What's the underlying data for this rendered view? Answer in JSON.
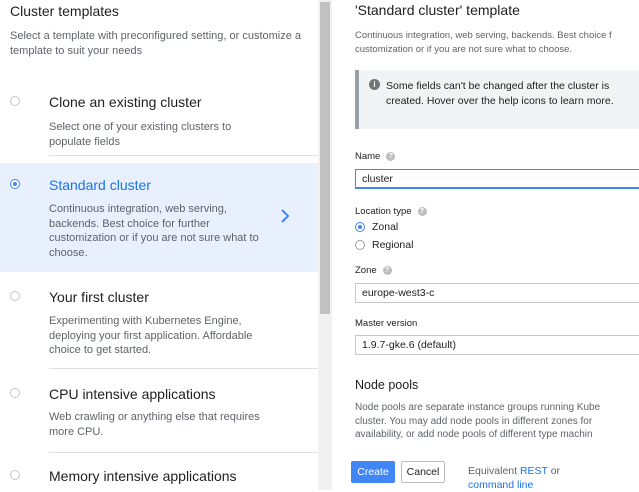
{
  "left": {
    "title": "Cluster templates",
    "subtitle": "Select a template with preconfigured setting, or customize a template to suit your needs",
    "templates": [
      {
        "title": "Clone an existing cluster",
        "description": "Select one of your existing clusters to populate fields"
      },
      {
        "title": "Standard cluster",
        "description": "Continuous integration, web serving, backends. Best choice for further customization or if you are not sure what to choose."
      },
      {
        "title": "Your first cluster",
        "description": "Experimenting with Kubernetes Engine, deploying your first application. Affordable choice to get started."
      },
      {
        "title": "CPU intensive applications",
        "description": "Web crawling or anything else that requires more CPU."
      },
      {
        "title": "Memory intensive applications",
        "description": ""
      }
    ],
    "selected_index": 1
  },
  "right": {
    "title": "'Standard cluster' template",
    "subtitle_line1": "Continuous integration, web serving, backends. Best choice f",
    "subtitle_line2": "customization or if you are not sure what to choose.",
    "info": "Some fields can't be changed after the cluster is created. Hover over the help icons to learn more.",
    "name_label": "Name",
    "name_value": "cluster",
    "location_label": "Location type",
    "location_options": [
      "Zonal",
      "Regional"
    ],
    "location_selected": "Zonal",
    "zone_label": "Zone",
    "zone_value": "europe-west3-c",
    "master_label": "Master version",
    "master_value": "1.9.7-gke.6 (default)",
    "node_pools_title": "Node pools",
    "node_pools_line1": "Node pools are separate instance groups running Kube",
    "node_pools_line2": "cluster. You may add node pools in different zones for",
    "node_pools_line3": "availability, or add node pools of different type machin"
  },
  "footer": {
    "create": "Create",
    "cancel": "Cancel",
    "equiv_prefix": "Equivalent",
    "rest": "REST",
    "or": "or",
    "command_line": "command line"
  },
  "colors": {
    "accent": "#4285f4",
    "selected_bg": "#e8f0fe",
    "selected_text": "#1a73e8"
  }
}
